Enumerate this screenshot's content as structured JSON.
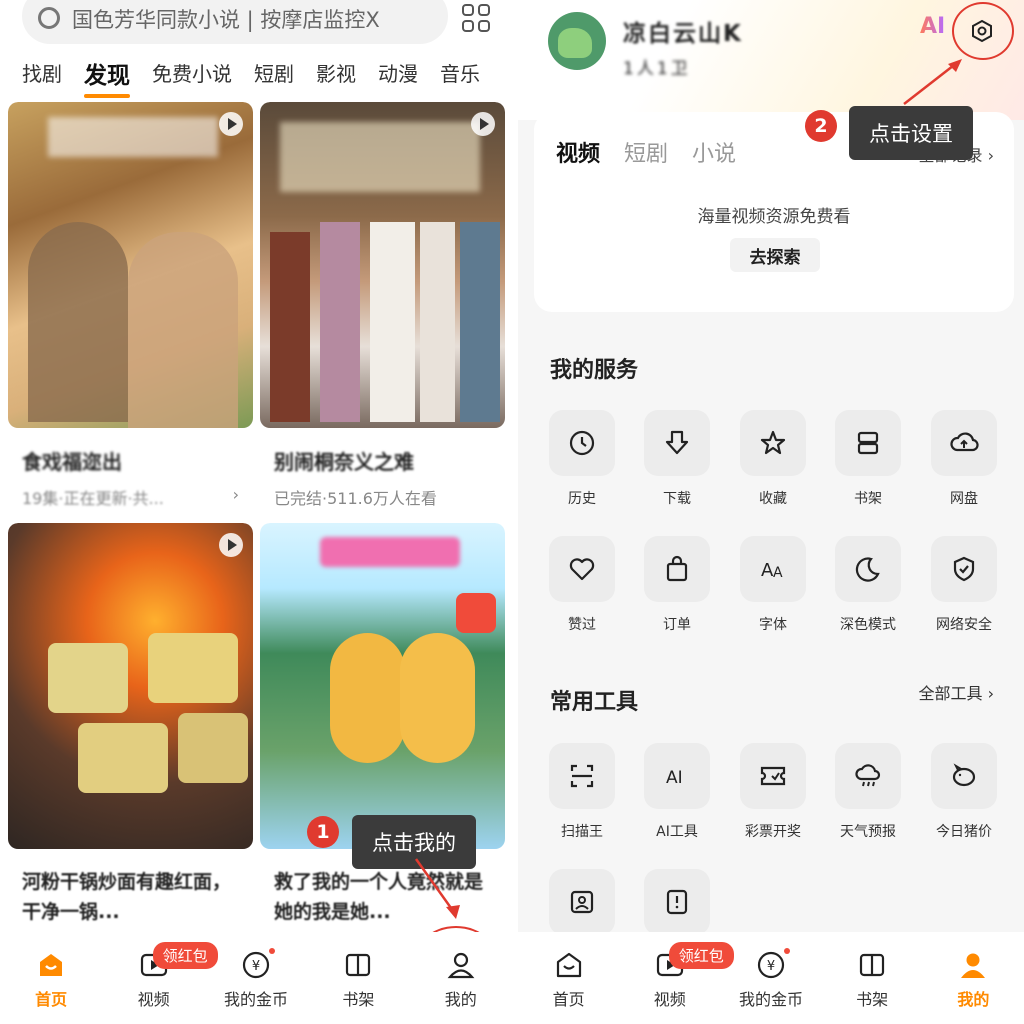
{
  "left": {
    "search": {
      "placeholder": "国色芳华同款小说 | 按摩店监控X"
    },
    "tabs": [
      "找剧",
      "发现",
      "免费小说",
      "短剧",
      "影视",
      "动漫",
      "音乐"
    ],
    "cards": [
      {
        "title": "食戏福迩出",
        "meta": "19集·正在更新·共...",
        "arrow": "›"
      },
      {
        "title": "别闹桐奈义之难",
        "meta": "已完结·511.6万人在看",
        "arrow": "›"
      },
      {
        "title": "河粉干锅炒面有趣红面，干净一锅...",
        "meta": ""
      },
      {
        "title": "救了我的一个人竟然就是她的我是她...",
        "meta": ""
      }
    ],
    "step1": {
      "num": "1",
      "text": "点击我的"
    },
    "nav": [
      {
        "label": "首页",
        "icon": "home-icon",
        "active": true
      },
      {
        "label": "视频",
        "icon": "video-icon",
        "badge": "领红包"
      },
      {
        "label": "我的金币",
        "icon": "coin-icon",
        "dot": true
      },
      {
        "label": "书架",
        "icon": "book-icon"
      },
      {
        "label": "我的",
        "icon": "person-icon"
      }
    ]
  },
  "right": {
    "user": {
      "name": "凉白云山K",
      "id": "1人1卫"
    },
    "ai_label": "AI",
    "step2": {
      "num": "2",
      "text": "点击设置"
    },
    "media_tabs": [
      "视频",
      "短剧",
      "小说"
    ],
    "all_records": "全部记录 ›",
    "media_empty": "海量视频资源免费看",
    "explore": "去探索",
    "services_title": "我的服务",
    "services": [
      {
        "label": "历史",
        "icon": "clock-icon"
      },
      {
        "label": "下载",
        "icon": "download-icon"
      },
      {
        "label": "收藏",
        "icon": "star-icon"
      },
      {
        "label": "书架",
        "icon": "bookshelf-icon"
      },
      {
        "label": "网盘",
        "icon": "cloud-upload-icon"
      },
      {
        "label": "赞过",
        "icon": "heart-icon"
      },
      {
        "label": "订单",
        "icon": "bag-icon"
      },
      {
        "label": "字体",
        "icon": "font-icon"
      },
      {
        "label": "深色模式",
        "icon": "moon-icon"
      },
      {
        "label": "网络安全",
        "icon": "shield-icon"
      }
    ],
    "tools_title": "常用工具",
    "tools_more": "全部工具 ›",
    "tools": [
      {
        "label": "扫描王",
        "icon": "scan-icon"
      },
      {
        "label": "AI工具",
        "icon": "ai-icon"
      },
      {
        "label": "彩票开奖",
        "icon": "ticket-icon"
      },
      {
        "label": "天气预报",
        "icon": "weather-icon"
      },
      {
        "label": "今日猪价",
        "icon": "pig-icon"
      },
      {
        "label": "",
        "icon": "contact-icon"
      },
      {
        "label": "",
        "icon": "report-icon"
      }
    ],
    "nav": [
      {
        "label": "首页",
        "icon": "home-icon"
      },
      {
        "label": "视频",
        "icon": "video-icon",
        "badge": "领红包"
      },
      {
        "label": "我的金币",
        "icon": "coin-icon",
        "dot": true
      },
      {
        "label": "书架",
        "icon": "book-icon"
      },
      {
        "label": "我的",
        "icon": "person-icon",
        "active": true
      }
    ]
  },
  "colors": {
    "accent": "#ff8a00",
    "annotation_red": "#e03a2f",
    "badge_red": "#f04b3a",
    "callout_bg": "#3b3b3b"
  }
}
